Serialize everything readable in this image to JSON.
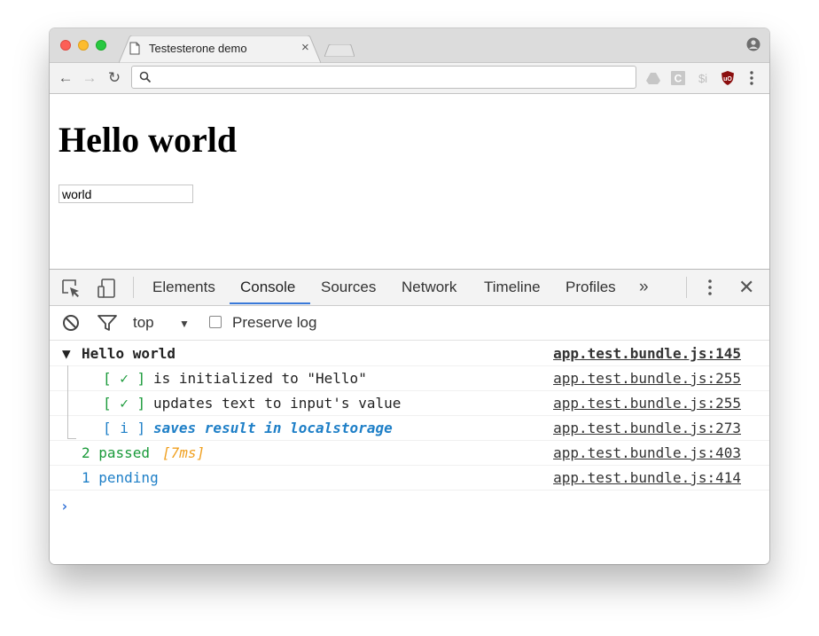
{
  "browser": {
    "tab_title": "Testesterone demo",
    "tab_close": "×",
    "omnibox_value": ""
  },
  "page": {
    "heading": "Hello world",
    "input_value": "world"
  },
  "devtools": {
    "tabs": [
      "Elements",
      "Console",
      "Sources",
      "Network",
      "Timeline",
      "Profiles"
    ],
    "active_tab": "Console",
    "more_tabs": "»",
    "close": "✕",
    "context": "top",
    "context_arrow": "▼",
    "preserve_log_label": "Preserve log",
    "preserve_log_checked": false
  },
  "console": {
    "lines": [
      {
        "prefix": "▼ ",
        "text": "Hello world",
        "source": "app.test.bundle.js:145",
        "color": "#222222"
      },
      {
        "badge": "[ ✓ ]",
        "text": "is initialized to \"Hello\"",
        "source": "app.test.bundle.js:255",
        "badge_color": "#1a9a3a",
        "color": "#222222"
      },
      {
        "badge": "[ ✓ ]",
        "text": "updates text to input's value",
        "source": "app.test.bundle.js:255",
        "badge_color": "#1a9a3a",
        "color": "#222222"
      },
      {
        "badge": "[ i ]",
        "text": "saves result in localstorage",
        "source": "app.test.bundle.js:273",
        "badge_color": "#1e7fc7",
        "color": "#1e7fc7"
      },
      {
        "text": "2 passed",
        "extra": "[7ms]",
        "source": "app.test.bundle.js:403",
        "color": "#1a9a3a",
        "extra_color": "#f0a020"
      },
      {
        "text": "1 pending",
        "source": "app.test.bundle.js:414",
        "color": "#1e7fc7"
      }
    ],
    "prompt": "›"
  },
  "colors": {
    "accent": "#3879d9",
    "pass": "#1a9a3a",
    "info": "#1e7fc7",
    "time": "#f0a020"
  }
}
